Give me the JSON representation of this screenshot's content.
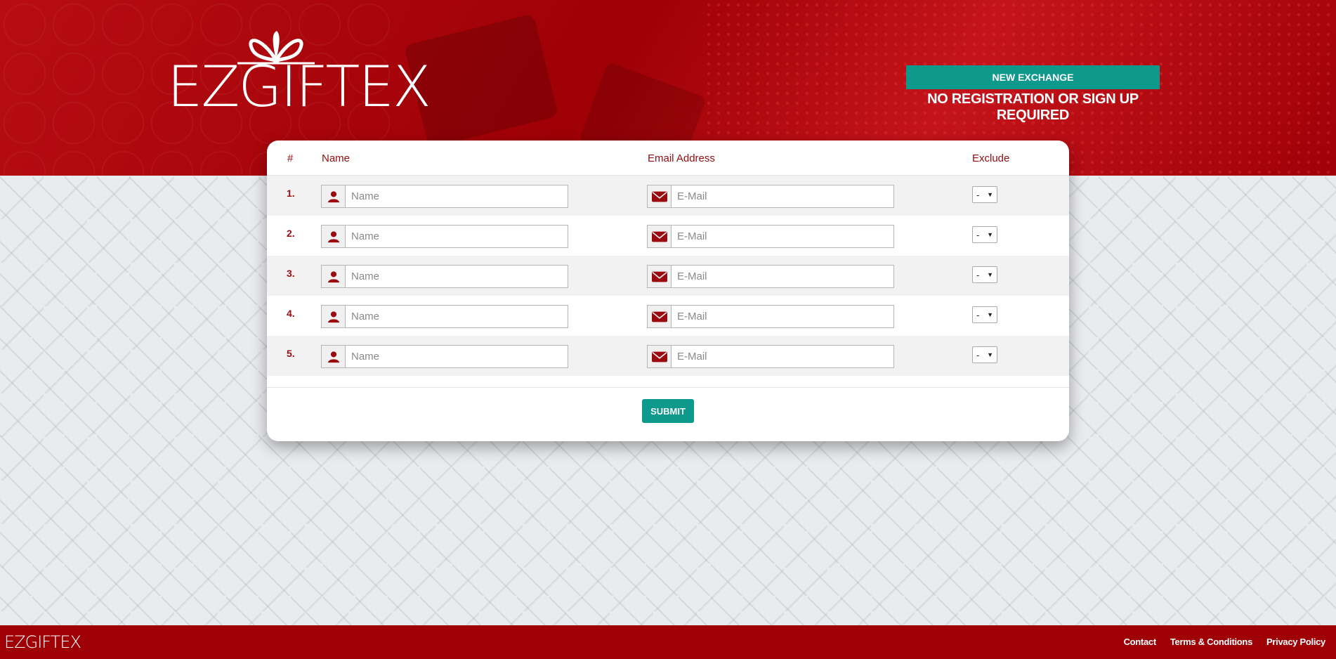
{
  "brand": {
    "logo_text": "EZGIFTEX",
    "colors": {
      "primary_red": "#9e0006",
      "teal": "#0d9a8c",
      "header_text": "#9a0a0f"
    }
  },
  "header": {
    "new_exchange_label": "NEW EXCHANGE",
    "tagline": "NO REGISTRATION OR SIGN UP REQUIRED"
  },
  "table": {
    "col_num": "#",
    "col_name": "Name",
    "col_email": "Email Address",
    "col_exclude": "Exclude",
    "rows": [
      {
        "num": "1.",
        "name_placeholder": "Name",
        "email_placeholder": "E-Mail",
        "exclude": "-"
      },
      {
        "num": "2.",
        "name_placeholder": "Name",
        "email_placeholder": "E-Mail",
        "exclude": "-"
      },
      {
        "num": "3.",
        "name_placeholder": "Name",
        "email_placeholder": "E-Mail",
        "exclude": "-"
      },
      {
        "num": "4.",
        "name_placeholder": "Name",
        "email_placeholder": "E-Mail",
        "exclude": "-"
      },
      {
        "num": "5.",
        "name_placeholder": "Name",
        "email_placeholder": "E-Mail",
        "exclude": "-"
      }
    ],
    "icons": {
      "name": "user-icon",
      "email": "envelope-icon",
      "exclude": "caret-down-icon"
    }
  },
  "submit_label": "SUBMIT",
  "footer": {
    "logo_text": "EZGIFTEX",
    "links": [
      "Contact",
      "Terms & Conditions",
      "Privacy Policy"
    ]
  }
}
